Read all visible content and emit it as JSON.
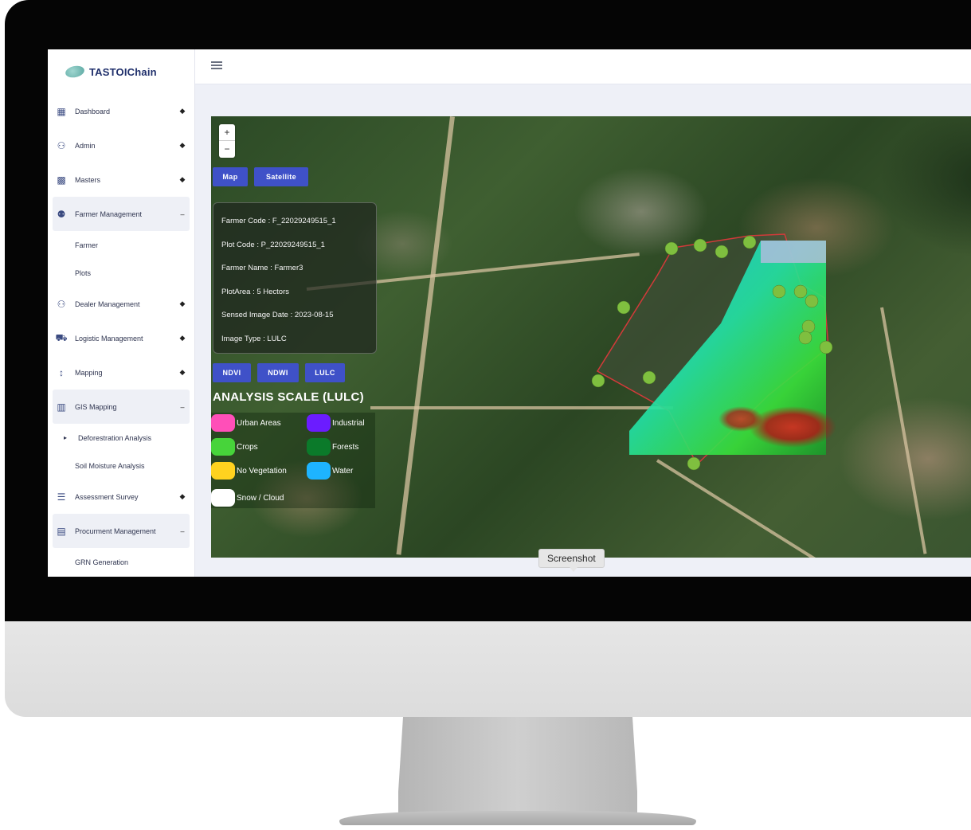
{
  "app": {
    "logo_text": "TASTOIChain"
  },
  "sidebar": {
    "items": [
      {
        "label": "Dashboard",
        "icon": "dashboard-icon",
        "caret": "◆"
      },
      {
        "label": "Admin",
        "icon": "admin-user-icon",
        "caret": "◆"
      },
      {
        "label": "Masters",
        "icon": "grid-icon",
        "caret": "◆"
      },
      {
        "label": "Farmer Management",
        "icon": "users-icon",
        "caret": "–"
      },
      {
        "label": "Farmer"
      },
      {
        "label": "Plots"
      },
      {
        "label": "Dealer Management",
        "icon": "dealer-icon",
        "caret": "◆"
      },
      {
        "label": "Logistic Management",
        "icon": "truck-icon",
        "caret": "◆"
      },
      {
        "label": "Mapping",
        "icon": "mapping-icon",
        "caret": "◆"
      },
      {
        "label": "GIS Mapping",
        "icon": "map-icon",
        "caret": "–"
      },
      {
        "label": "Deforestration Analysis",
        "bullet": "▸"
      },
      {
        "label": "Soil Moisture Analysis"
      },
      {
        "label": "Assessment Survey",
        "icon": "list-icon",
        "caret": "◆"
      },
      {
        "label": "Procurment Management",
        "icon": "procurement-icon",
        "caret": "–"
      },
      {
        "label": "GRN Generation"
      }
    ]
  },
  "map": {
    "zoom_in": "+",
    "zoom_out": "−",
    "type_buttons": {
      "map": "Map",
      "satellite": "Satellite"
    },
    "info": {
      "farmer_code": "Farmer Code : F_22029249515_1",
      "plot_code": "Plot Code : P_22029249515_1",
      "farmer_name": "Farmer Name : Farmer3",
      "plot_area": "PlotArea : 5 Hectors",
      "sensed_date": "Sensed Image Date : 2023-08-15",
      "image_type": "Image Type : LULC"
    },
    "analysis_buttons": {
      "ndvi": "NDVI",
      "ndwi": "NDWI",
      "lulc": "LULC"
    },
    "scale_title": "ANALYSIS SCALE (LULC)",
    "legend": [
      {
        "label": "Urban Areas",
        "color": "#ff4fb8"
      },
      {
        "label": "Industrial",
        "color": "#6b1cff"
      },
      {
        "label": "Crops",
        "color": "#47d43a"
      },
      {
        "label": "Forests",
        "color": "#0b7a2a"
      },
      {
        "label": "No Vegetation",
        "color": "#ffd21f"
      },
      {
        "label": "Water",
        "color": "#1eb4ff"
      },
      {
        "label": "Snow / Cloud",
        "color": "#ffffff"
      }
    ]
  },
  "tooltip": {
    "text": "Screenshot"
  },
  "colors": {
    "accent": "#3f51c8",
    "plot_outline": "#d23a3a",
    "tree_marker": "#7fbf3f"
  }
}
